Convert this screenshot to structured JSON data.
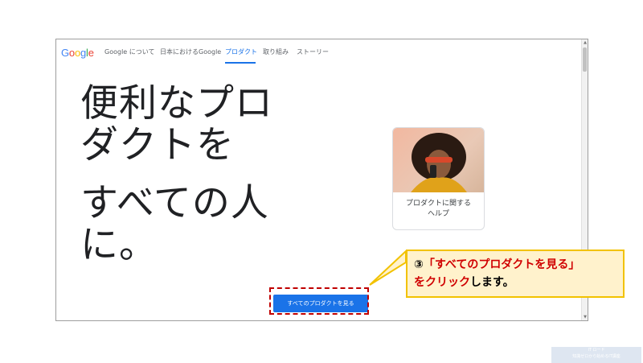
{
  "nav": {
    "logo": "Google",
    "items": [
      "Google について",
      "日本におけるGoogle",
      "プロダクト",
      "取り組み",
      "ストーリー"
    ],
    "active_index": 2
  },
  "hero": {
    "line1": "便利なプロ",
    "line2": "ダクトを",
    "line3": "すべての人",
    "line4": "に。"
  },
  "card": {
    "label_line1": "プロダクトに関する",
    "label_line2": "ヘルプ"
  },
  "cta": {
    "label": "すべてのプロダクトを見る"
  },
  "callout": {
    "step": "③",
    "quote": "「すべてのプロダクトを見る」",
    "line2_red": "をクリック",
    "line2_rest": "します。"
  },
  "watermark": {
    "line1": "IT ロード",
    "line2": "知識ゼロから始めるIT講座"
  },
  "colors": {
    "accent": "#1a73e8",
    "highlight_border": "#c00000",
    "callout_bg": "#fff2cc",
    "callout_border": "#f2c200"
  }
}
